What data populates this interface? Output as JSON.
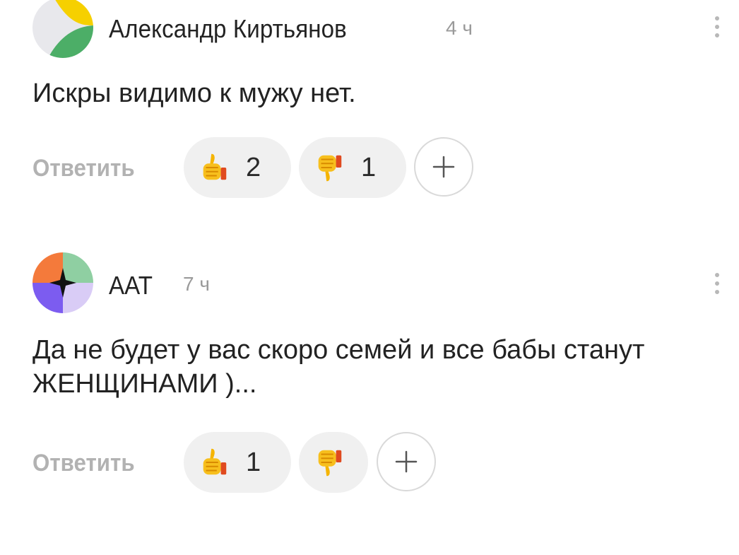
{
  "comments": [
    {
      "author": "Александр Киртьянов",
      "time": "4 ч",
      "text": "Искры видимо к мужу нет.",
      "reply_label": "Ответить",
      "likes": "2",
      "dislikes": "1",
      "avatar_colors": [
        "#f6d000",
        "#4cae67",
        "#e8e8ec"
      ]
    },
    {
      "author": "ААТ",
      "time": "7 ч",
      "text": "Да не будет у вас скоро семей и все бабы станут ЖЕНЩИНАМИ )...",
      "reply_label": "Ответить",
      "likes": "1",
      "dislikes": "",
      "avatar_colors": [
        "#f47a3b",
        "#8fcfa2",
        "#7c5cf0",
        "#d9ccf6"
      ]
    }
  ],
  "icons": {
    "like": "thumbs-up-icon",
    "dislike": "thumbs-down-icon",
    "add": "plus-icon",
    "menu": "more-vertical-icon"
  },
  "colors": {
    "pill_bg": "#f0f0f0",
    "muted_text": "#9a9a9a",
    "reply_text": "#b2b2b2"
  }
}
